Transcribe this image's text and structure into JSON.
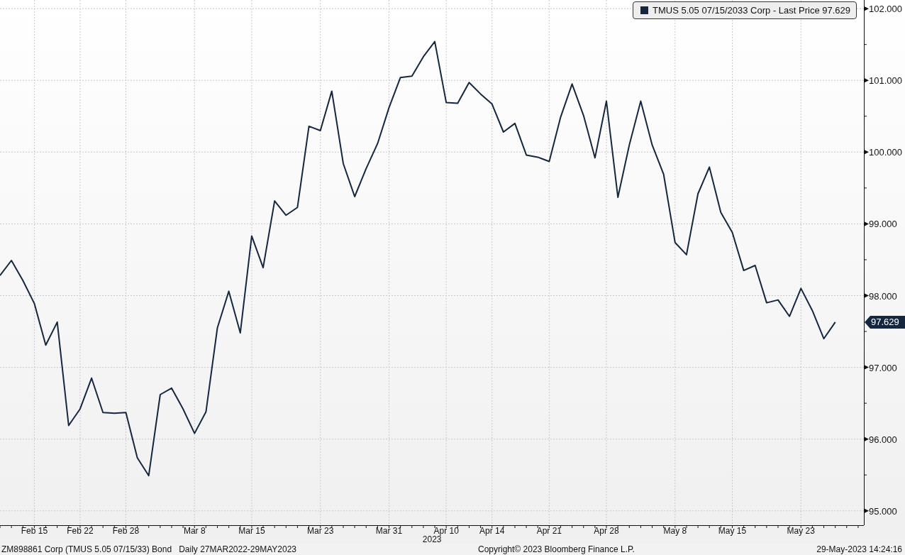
{
  "legend": {
    "label": "TMUS 5.05 07/15/2033 Corp - Last Price 97.629"
  },
  "chart": {
    "chart_data": {
      "type": "line",
      "categories": [
        null,
        null,
        null,
        "Feb 15",
        null,
        null,
        null,
        "Feb 22",
        null,
        null,
        null,
        "Feb 28",
        null,
        null,
        null,
        null,
        null,
        "Mar 8",
        null,
        null,
        null,
        null,
        "Mar 15",
        null,
        null,
        null,
        null,
        null,
        "Mar 23",
        null,
        null,
        null,
        null,
        null,
        "Mar 31",
        null,
        null,
        null,
        null,
        "Apr 10",
        null,
        null,
        null,
        "Apr 14",
        null,
        null,
        null,
        null,
        "Apr 21",
        null,
        null,
        null,
        null,
        "Apr 28",
        null,
        null,
        null,
        null,
        null,
        "May 8",
        null,
        null,
        null,
        null,
        "May 15",
        null,
        null,
        null,
        null,
        null,
        "May 23",
        null,
        null,
        null
      ],
      "series": [
        {
          "color": "#14273f",
          "values": [
            98.28,
            98.49,
            98.21,
            97.89,
            97.31,
            97.63,
            96.19,
            96.42,
            96.85,
            96.37,
            96.36,
            96.37,
            95.74,
            95.49,
            96.62,
            96.71,
            96.42,
            96.08,
            96.38,
            97.55,
            98.06,
            97.48,
            98.83,
            98.39,
            99.32,
            99.12,
            99.23,
            100.36,
            100.3,
            100.85,
            99.84,
            99.38,
            99.77,
            100.12,
            100.62,
            101.04,
            101.06,
            101.33,
            101.54,
            100.69,
            100.68,
            100.97,
            100.81,
            100.67,
            100.28,
            100.4,
            99.96,
            99.93,
            99.87,
            100.49,
            100.95,
            100.51,
            99.92,
            100.71,
            99.37,
            100.1,
            100.71,
            100.1,
            99.69,
            98.74,
            98.57,
            99.42,
            99.79,
            99.16,
            98.88,
            98.35,
            98.42,
            97.9,
            97.94,
            97.71,
            98.1,
            97.79,
            97.4,
            97.63
          ]
        }
      ],
      "ylim": [
        94.8,
        102.12
      ],
      "grid": true,
      "yticks": [
        {
          "value": 95,
          "label": "95.000"
        },
        {
          "value": 96,
          "label": "96.000"
        },
        {
          "value": 97,
          "label": "97.000"
        },
        {
          "value": 98,
          "label": "98.000"
        },
        {
          "value": 99,
          "label": "99.000"
        },
        {
          "value": 100,
          "label": "100.000"
        },
        {
          "value": 101,
          "label": "101.000"
        },
        {
          "value": 102,
          "label": "102.000"
        }
      ]
    },
    "last_price_tag": "97.629",
    "year_label": "2023"
  },
  "footer": {
    "security": "ZM898861 Corp (TMUS 5.05 07/15/33) Bond",
    "range": "Daily 27MAR2022-29MAY2023",
    "copyright": "Copyright© 2023 Bloomberg Finance L.P.",
    "timestamp": "29-May-2023 14:24:16"
  }
}
